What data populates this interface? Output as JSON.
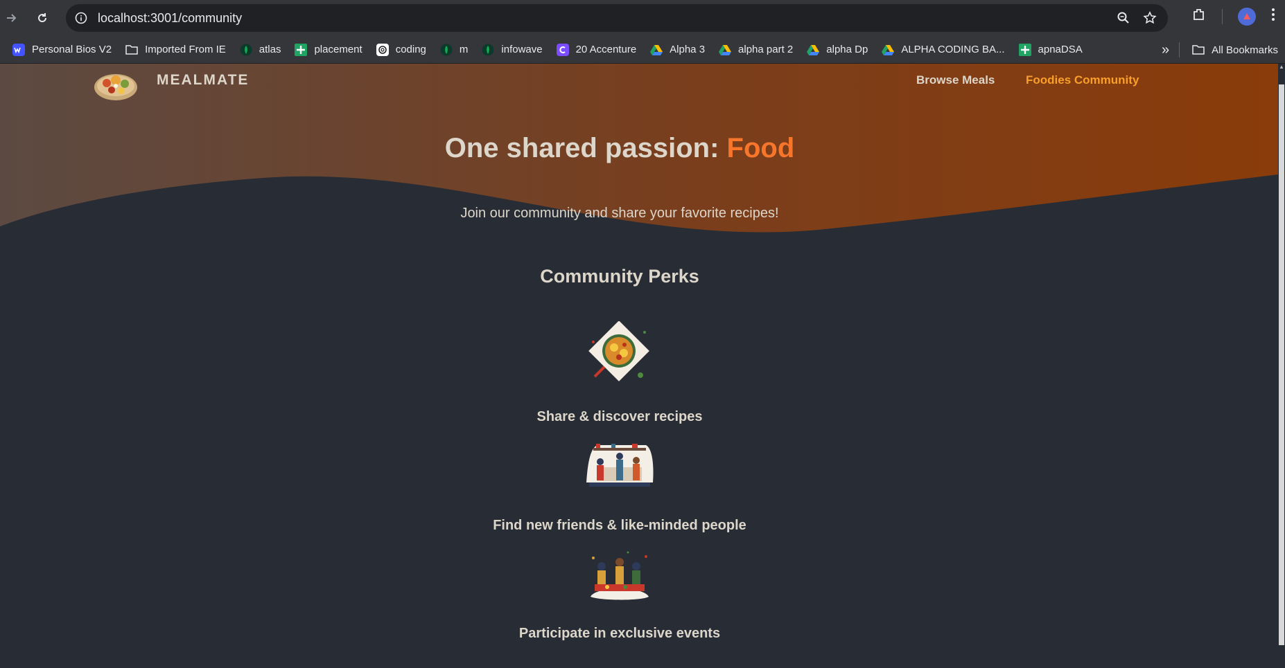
{
  "browser": {
    "url": "localhost:3001/community",
    "bookmarks": [
      {
        "label": "Personal Bios V2",
        "icon": "webflow-icon",
        "color": "#4353ff"
      },
      {
        "label": "Imported From IE",
        "icon": "folder-icon",
        "color": "none"
      },
      {
        "label": "atlas",
        "icon": "mongodb-leaf-icon",
        "color": "#13aa52"
      },
      {
        "label": "placement",
        "icon": "sheets-plus-icon",
        "color": "#1fa463"
      },
      {
        "label": "coding",
        "icon": "openai-icon",
        "color": "#ffffff"
      },
      {
        "label": "m",
        "icon": "mongodb-leaf-icon",
        "color": "#13aa52"
      },
      {
        "label": "infowave",
        "icon": "mongodb-leaf-icon",
        "color": "#13aa52"
      },
      {
        "label": "20 Accenture",
        "icon": "c-logo-icon",
        "color": "#7b4dff"
      },
      {
        "label": "Alpha 3",
        "icon": "drive-icon",
        "color": "#fbbc04"
      },
      {
        "label": "alpha part 2",
        "icon": "drive-icon",
        "color": "#fbbc04"
      },
      {
        "label": "alpha Dp",
        "icon": "drive-icon",
        "color": "#fbbc04"
      },
      {
        "label": "ALPHA CODING BA...",
        "icon": "drive-icon",
        "color": "#fbbc04"
      },
      {
        "label": "apnaDSA",
        "icon": "sheets-plus-icon",
        "color": "#1fa463"
      }
    ],
    "all_bookmarks": "All Bookmarks"
  },
  "header": {
    "brand": "MEALMATE",
    "nav": [
      {
        "label": "Browse Meals",
        "active": false
      },
      {
        "label": "Foodies Community",
        "active": true
      }
    ]
  },
  "hero": {
    "title_prefix": "One shared passion: ",
    "title_accent": "Food",
    "subtitle": "Join our community and share your favorite recipes!"
  },
  "perks": {
    "title": "Community Perks",
    "items": [
      {
        "label": "Share & discover recipes",
        "image": "meal-plate-image"
      },
      {
        "label": "Find new friends & like-minded people",
        "image": "community-kitchen-image"
      },
      {
        "label": "Participate in exclusive events",
        "image": "events-image"
      }
    ]
  },
  "colors": {
    "background": "#282c34",
    "text": "#ddd6cb",
    "accent": "#f8762c",
    "nav_active": "#f99f2a",
    "hero_gradient_start": "#5c4a42",
    "hero_gradient_end": "#8a3c0a"
  }
}
